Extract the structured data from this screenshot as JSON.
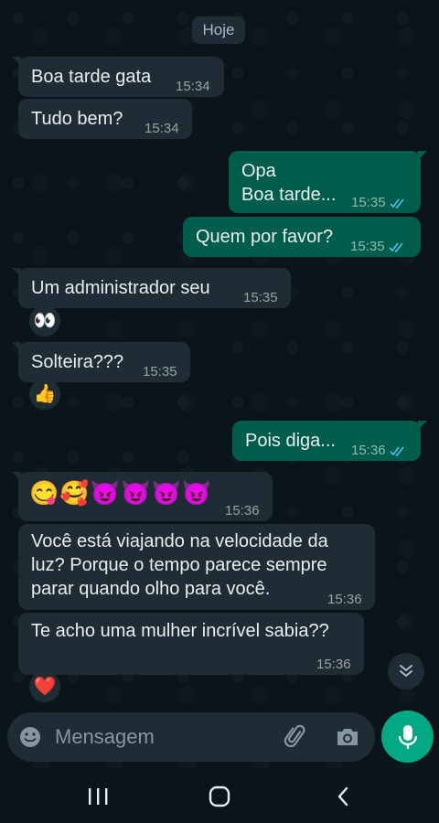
{
  "date_chip": "Hoje",
  "messages": [
    {
      "dir": "in",
      "text": "Boa tarde gata",
      "time": "15:34"
    },
    {
      "dir": "in",
      "text": "Tudo bem?",
      "time": "15:34"
    },
    {
      "dir": "out",
      "text": "Opa\nBoa tarde...",
      "time": "15:35",
      "status": "read"
    },
    {
      "dir": "out",
      "text": "Quem por favor?",
      "time": "15:35",
      "status": "read"
    },
    {
      "dir": "in",
      "text": "Um administrador seu",
      "time": "15:35",
      "reaction": "👀"
    },
    {
      "dir": "in",
      "text": "Solteira???",
      "time": "15:35",
      "reaction": "👍"
    },
    {
      "dir": "out",
      "text": "Pois diga...",
      "time": "15:36",
      "status": "read"
    },
    {
      "dir": "in",
      "text": "😋🥰😈😈😈😈",
      "time": "15:36"
    },
    {
      "dir": "in",
      "text": "Você está viajando na velocidade da\nluz? Porque o tempo parece sempre\nparar quando olho para você.",
      "time": "15:36"
    },
    {
      "dir": "in",
      "text": "Te acho uma mulher incrível sabia??",
      "time": "15:36",
      "reaction": "❤️"
    }
  ],
  "composer": {
    "placeholder": "Mensagem"
  },
  "icons": {
    "emoji": "emoji-icon",
    "attach": "paperclip-icon",
    "camera": "camera-icon",
    "mic": "mic-icon",
    "scroll": "chevrons-down-icon",
    "nav_recents": "recents-icon",
    "nav_home": "home-icon",
    "nav_back": "back-icon"
  },
  "colors": {
    "incoming": "#202c33",
    "outgoing": "#005c4b",
    "accent": "#00a884",
    "read_ticks": "#53bdeb"
  }
}
